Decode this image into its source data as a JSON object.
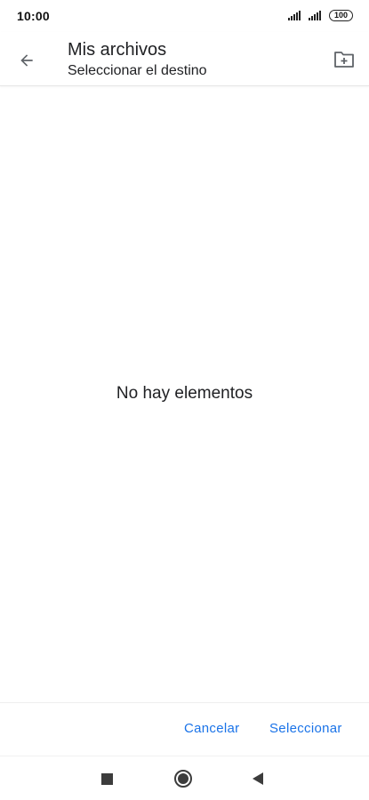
{
  "status_bar": {
    "time": "10:00",
    "battery": "100",
    "icons": [
      "signal-icon",
      "signal-icon",
      "battery-icon"
    ]
  },
  "app_bar": {
    "back_icon": "arrow-back-icon",
    "title": "Mis archivos",
    "subtitle": "Seleccionar el destino",
    "new_folder_icon": "new-folder-icon"
  },
  "content": {
    "empty_message": "No hay elementos"
  },
  "actions": {
    "cancel_label": "Cancelar",
    "select_label": "Seleccionar"
  },
  "colors": {
    "accent": "#1a73e8",
    "text": "#202124",
    "icon": "#5f6368"
  },
  "nav_bar": {
    "icons": [
      "recents-icon",
      "home-icon",
      "back-triangle-icon"
    ]
  }
}
